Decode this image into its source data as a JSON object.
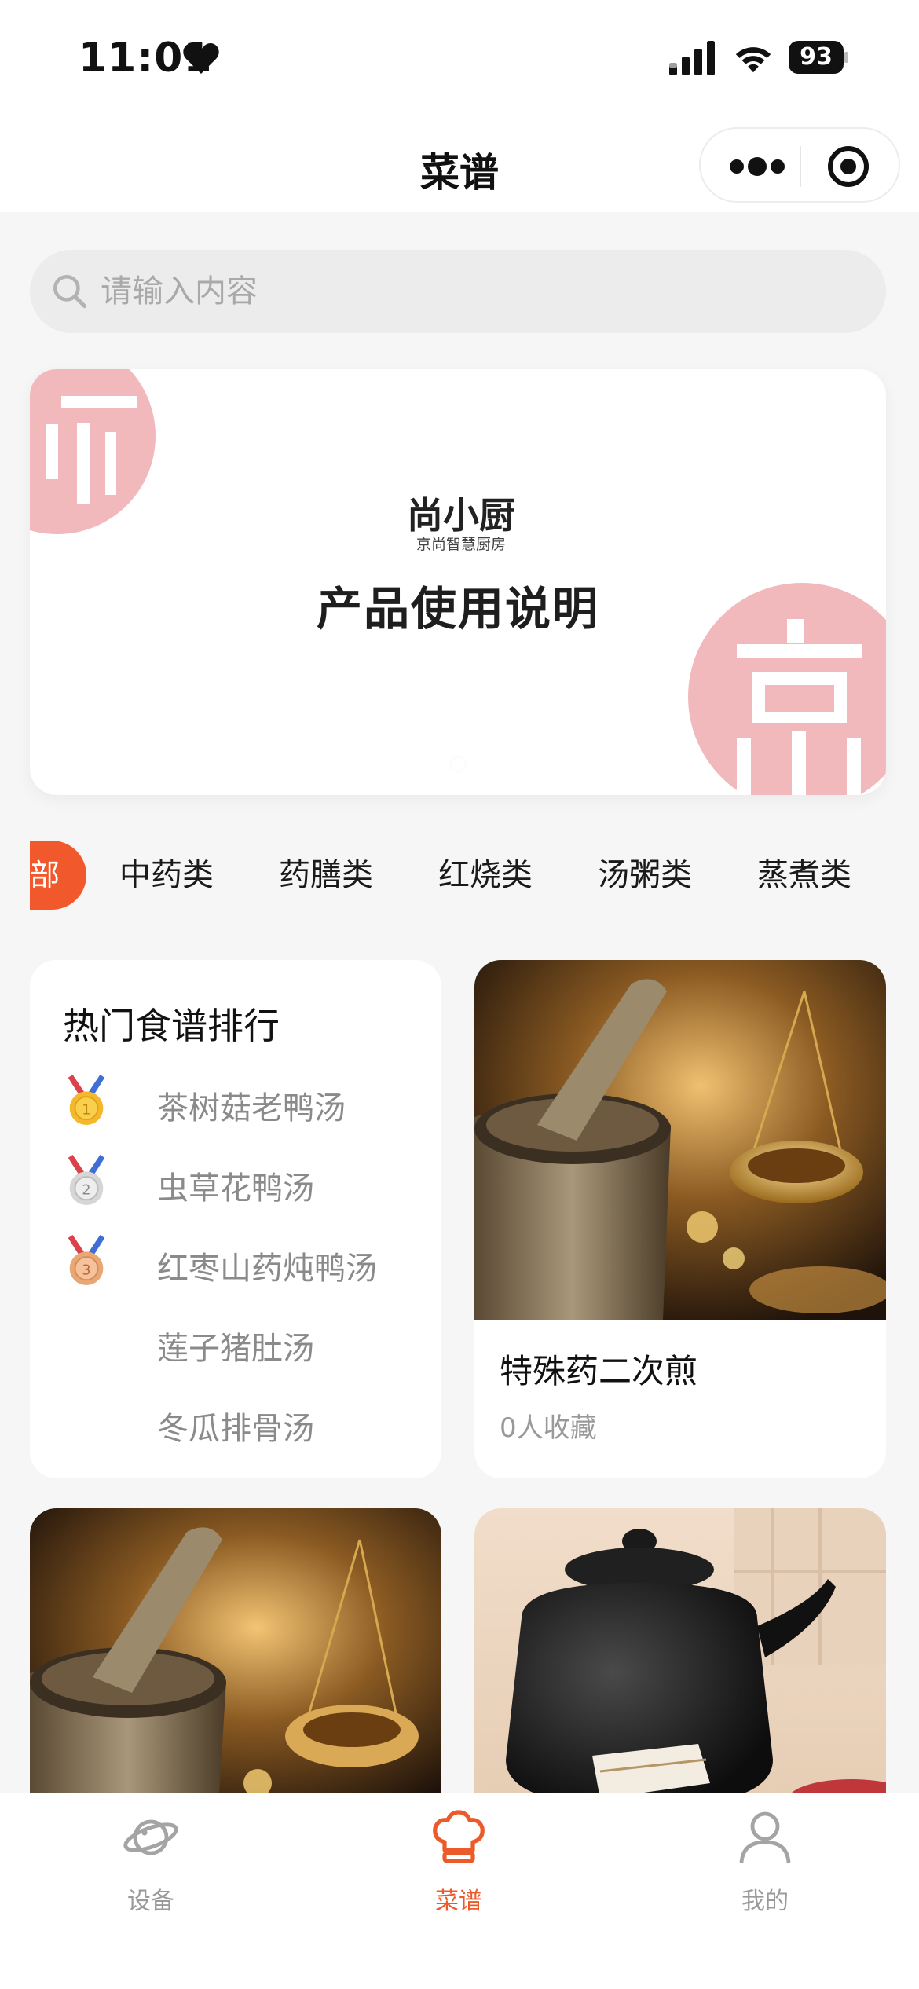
{
  "status_bar": {
    "time": "11:01",
    "battery": "93"
  },
  "nav": {
    "title": "菜谱"
  },
  "search": {
    "placeholder": "请输入内容"
  },
  "banner": {
    "logo_main": "尚小厨",
    "logo_sub": "京尚智慧厨房",
    "title": "产品使用说明"
  },
  "categories": {
    "active_partial": "部",
    "items": [
      "中药类",
      "药膳类",
      "红烧类",
      "汤粥类",
      "蒸煮类"
    ]
  },
  "ranking": {
    "title": "热门食谱排行",
    "items": [
      {
        "label": "茶树菇老鸭汤",
        "medal": "1"
      },
      {
        "label": "虫草花鸭汤",
        "medal": "2"
      },
      {
        "label": "红枣山药炖鸭汤",
        "medal": "3"
      },
      {
        "label": "莲子猪肚汤"
      },
      {
        "label": "冬瓜排骨汤"
      }
    ]
  },
  "recipe_card": {
    "name": "特殊药二次煎",
    "favorites": "0人收藏"
  },
  "tabbar": {
    "items": [
      "设备",
      "菜谱",
      "我的"
    ],
    "active": "菜谱"
  },
  "colors": {
    "accent": "#f1582b",
    "seal": "#f2b9bd",
    "muted_text": "#8a8a8a"
  }
}
